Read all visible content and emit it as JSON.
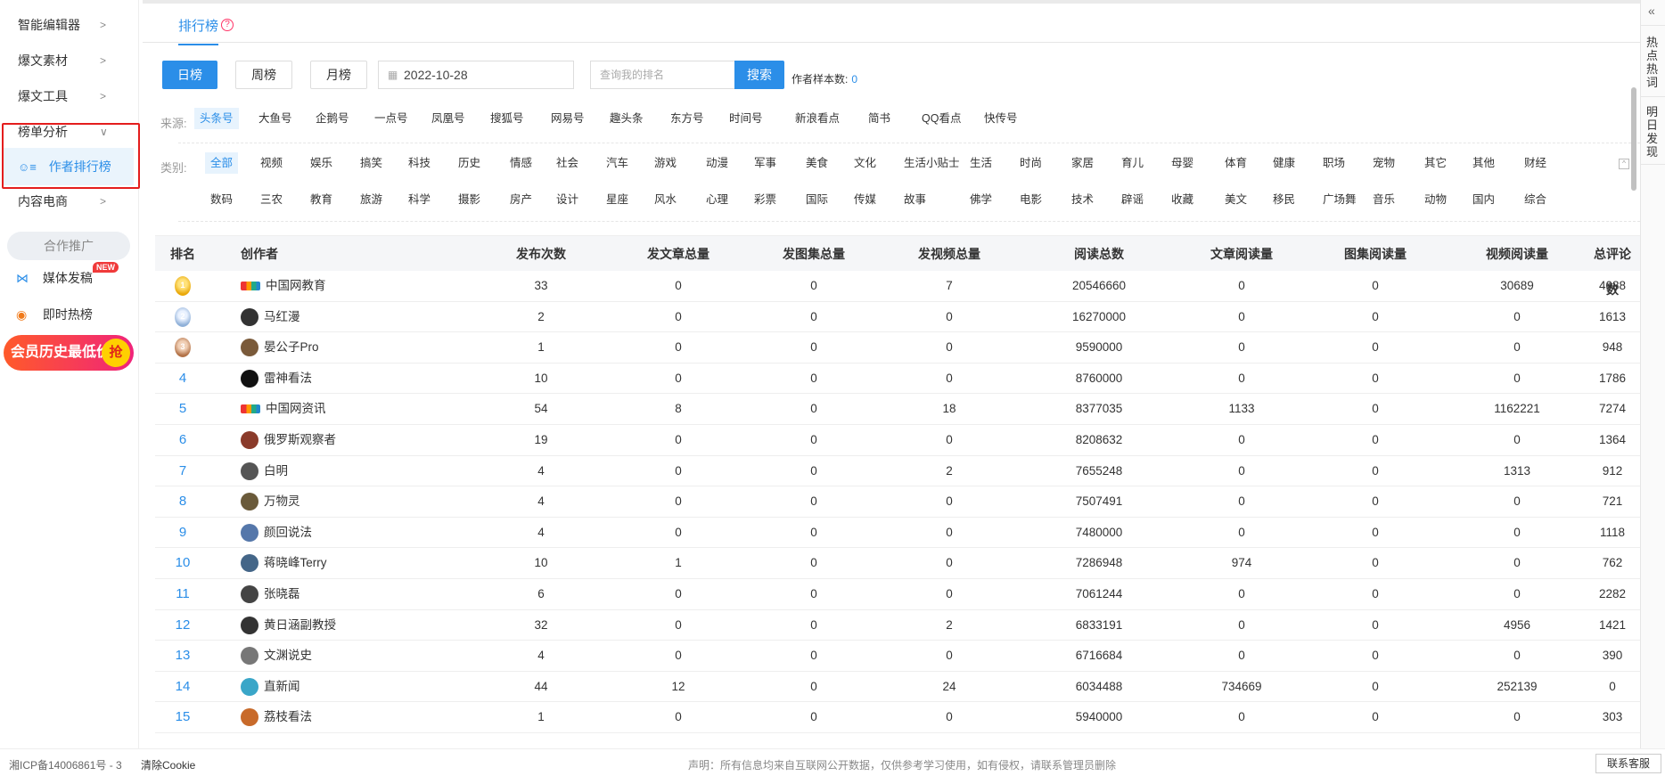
{
  "sidebar": {
    "items": [
      {
        "label": "智能编辑器",
        "chevron": ">"
      },
      {
        "label": "爆文素材",
        "chevron": ">"
      },
      {
        "label": "爆文工具",
        "chevron": ">"
      },
      {
        "label": "榜单分析",
        "chevron": "∨"
      },
      {
        "label": "内容电商",
        "chevron": ">"
      }
    ],
    "active_sub": "作者排行榜",
    "coop_label": "合作推广",
    "media_label": "媒体发稿",
    "new_badge": "NEW",
    "hot_label": "即时热榜",
    "promo_text": "会员历史最低价",
    "promo_grab": "抢"
  },
  "tabs": {
    "active": "排行榜",
    "help": "?"
  },
  "toolbar": {
    "day": "日榜",
    "week": "周榜",
    "month": "月榜",
    "date": "2022-10-28",
    "search_placeholder": "查询我的排名",
    "search_button": "搜索",
    "sample_label": "作者样本数:",
    "sample_value": "0"
  },
  "source": {
    "label": "来源:",
    "options": [
      "头条号",
      "大鱼号",
      "企鹅号",
      "一点号",
      "凤凰号",
      "搜狐号",
      "网易号",
      "趣头条",
      "东方号",
      "时间号",
      "新浪看点",
      "简书",
      "QQ看点",
      "快传号"
    ],
    "active": "头条号"
  },
  "category": {
    "label": "类别:",
    "row1": [
      "全部",
      "视频",
      "娱乐",
      "搞笑",
      "科技",
      "历史",
      "情感",
      "社会",
      "汽车",
      "游戏",
      "动漫",
      "军事",
      "美食",
      "文化",
      "生活小贴士",
      "生活",
      "时尚",
      "家居",
      "育儿",
      "母婴",
      "体育",
      "健康",
      "职场",
      "宠物",
      "其它",
      "其他",
      "财经"
    ],
    "row2": [
      "数码",
      "三农",
      "教育",
      "旅游",
      "科学",
      "摄影",
      "房产",
      "设计",
      "星座",
      "风水",
      "心理",
      "彩票",
      "国际",
      "传媒",
      "故事",
      "佛学",
      "电影",
      "技术",
      "辟谣",
      "收藏",
      "美文",
      "移民",
      "广场舞",
      "音乐",
      "动物",
      "国内",
      "综合"
    ],
    "active": "全部"
  },
  "table": {
    "headers": [
      "排名",
      "创作者",
      "发布次数",
      "发文章总量",
      "发图集总量",
      "发视频总量",
      "阅读总数",
      "文章阅读量",
      "图集阅读量",
      "视频阅读量",
      "总评论数"
    ],
    "rows": [
      {
        "rank": "1",
        "name": "中国网教育",
        "v": [
          "33",
          "0",
          "0",
          "7",
          "20546660",
          "0",
          "0",
          "30689",
          "4088"
        ]
      },
      {
        "rank": "2",
        "name": "马红漫",
        "v": [
          "2",
          "0",
          "0",
          "0",
          "16270000",
          "0",
          "0",
          "0",
          "1613"
        ]
      },
      {
        "rank": "3",
        "name": "晏公子Pro",
        "v": [
          "1",
          "0",
          "0",
          "0",
          "9590000",
          "0",
          "0",
          "0",
          "948"
        ]
      },
      {
        "rank": "4",
        "name": "雷神看法",
        "v": [
          "10",
          "0",
          "0",
          "0",
          "8760000",
          "0",
          "0",
          "0",
          "1786"
        ]
      },
      {
        "rank": "5",
        "name": "中国网资讯",
        "v": [
          "54",
          "8",
          "0",
          "18",
          "8377035",
          "1133",
          "0",
          "1162221",
          "7274"
        ]
      },
      {
        "rank": "6",
        "name": "俄罗斯观察者",
        "v": [
          "19",
          "0",
          "0",
          "0",
          "8208632",
          "0",
          "0",
          "0",
          "1364"
        ]
      },
      {
        "rank": "7",
        "name": "白明",
        "v": [
          "4",
          "0",
          "0",
          "2",
          "7655248",
          "0",
          "0",
          "1313",
          "912"
        ]
      },
      {
        "rank": "8",
        "name": "万物灵",
        "v": [
          "4",
          "0",
          "0",
          "0",
          "7507491",
          "0",
          "0",
          "0",
          "721"
        ]
      },
      {
        "rank": "9",
        "name": "颜回说法",
        "v": [
          "4",
          "0",
          "0",
          "0",
          "7480000",
          "0",
          "0",
          "0",
          "1118"
        ]
      },
      {
        "rank": "10",
        "name": "蒋晓峰Terry",
        "v": [
          "10",
          "1",
          "0",
          "0",
          "7286948",
          "974",
          "0",
          "0",
          "762"
        ]
      },
      {
        "rank": "11",
        "name": "张晓磊",
        "v": [
          "6",
          "0",
          "0",
          "0",
          "7061244",
          "0",
          "0",
          "0",
          "2282"
        ]
      },
      {
        "rank": "12",
        "name": "黄日涵副教授",
        "v": [
          "32",
          "0",
          "0",
          "2",
          "6833191",
          "0",
          "0",
          "4956",
          "1421"
        ]
      },
      {
        "rank": "13",
        "name": "文渊说史",
        "v": [
          "4",
          "0",
          "0",
          "0",
          "6716684",
          "0",
          "0",
          "0",
          "390"
        ]
      },
      {
        "rank": "14",
        "name": "直新闻",
        "v": [
          "44",
          "12",
          "0",
          "24",
          "6034488",
          "734669",
          "0",
          "252139",
          "0"
        ]
      },
      {
        "rank": "15",
        "name": "荔枝看法",
        "v": [
          "1",
          "0",
          "0",
          "0",
          "5940000",
          "0",
          "0",
          "0",
          "303"
        ]
      }
    ]
  },
  "rail": {
    "collapse": "«",
    "hot": "热点热词",
    "tomorrow": "明日发现"
  },
  "footer": {
    "icp": "湘ICP备14006861号 - 3",
    "cookie": "清除Cookie",
    "notice": "声明：所有信息均来自互联网公开数据，仅供参考学习使用，如有侵权，请联系管理员删除",
    "service": "联系客服"
  },
  "colors": {
    "accent": "#2b8ee8",
    "highlight_border": "#e41d1d"
  }
}
